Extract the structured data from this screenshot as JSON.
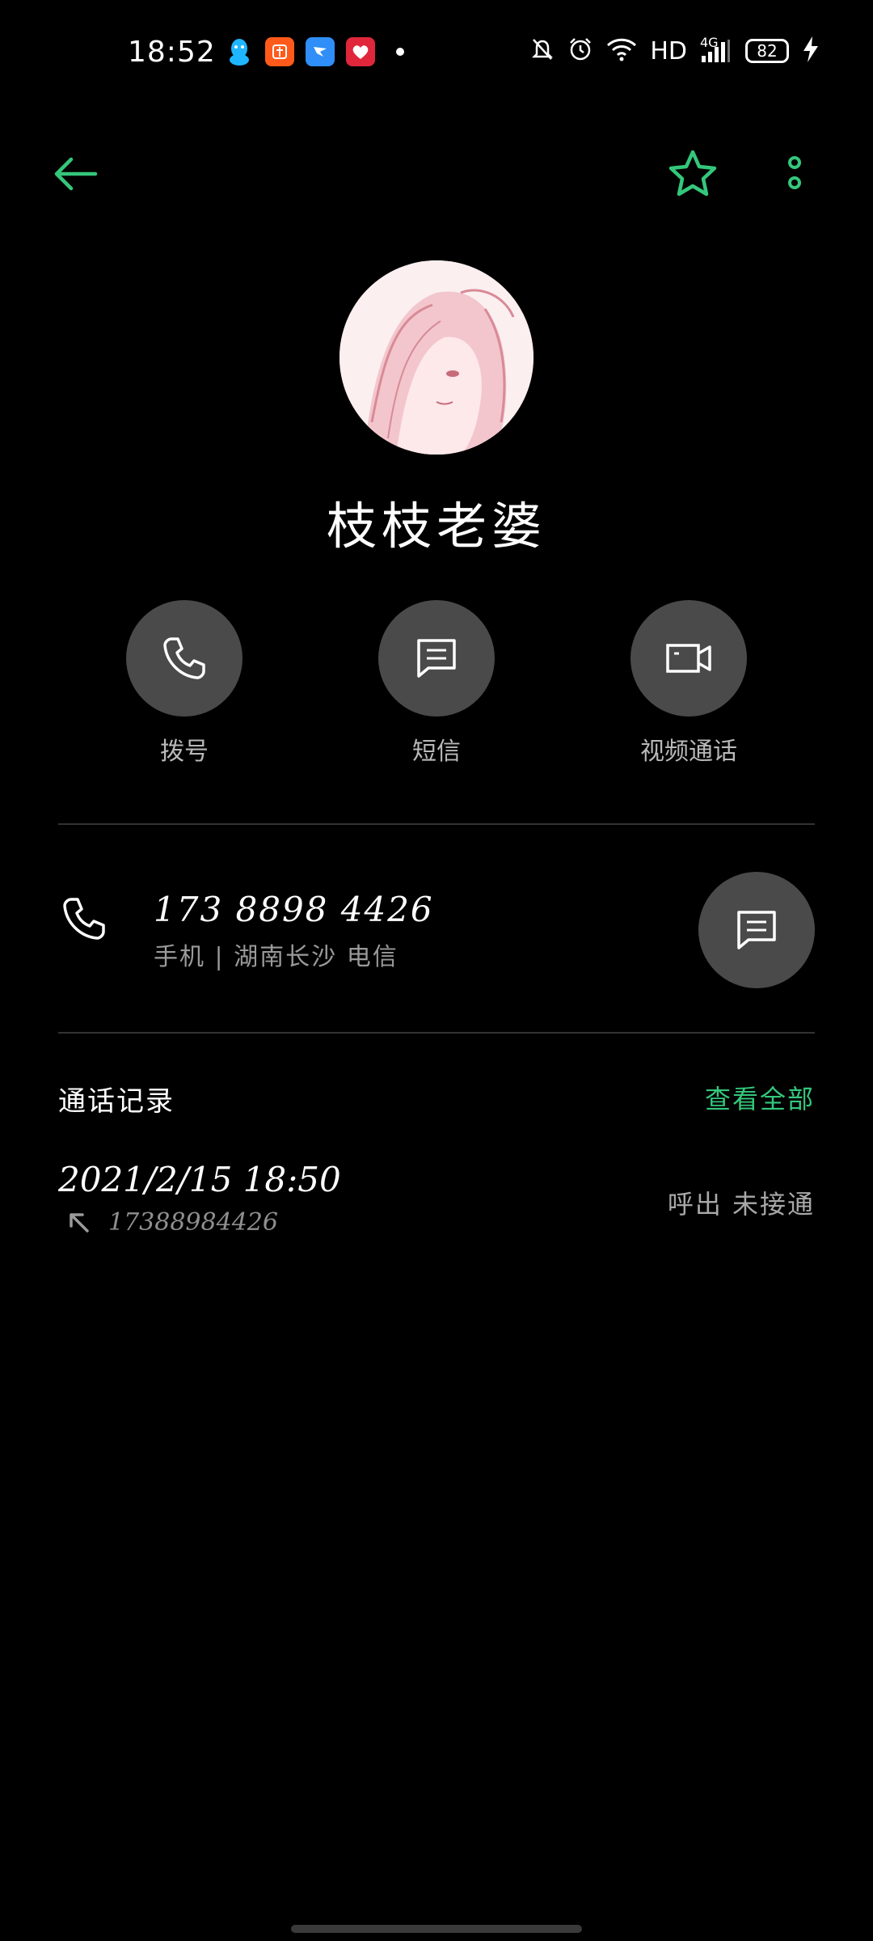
{
  "status_bar": {
    "time": "18:52",
    "hd_label": "HD",
    "network_label": "4G",
    "battery": "82",
    "icons": [
      "qq-icon",
      "taobao-icon",
      "dingtalk-icon",
      "heart-app-icon",
      "notification-dot",
      "mute-icon",
      "alarm-icon",
      "wifi-icon",
      "signal-icon",
      "charging-icon"
    ]
  },
  "top_bar": {
    "back_icon": "arrow-left-icon",
    "favorite_icon": "star-icon",
    "more_icon": "more-vertical-icon",
    "accent_color": "#34c77b"
  },
  "contact": {
    "name": "枝枝老婆",
    "avatar": "avatar"
  },
  "quick_actions": [
    {
      "label": "拨号",
      "icon": "phone-icon"
    },
    {
      "label": "短信",
      "icon": "message-icon"
    },
    {
      "label": "视频通话",
      "icon": "video-icon"
    }
  ],
  "phone_entry": {
    "number": "173 8898 4426",
    "subtitle": "手机 | 湖南长沙 电信",
    "message_icon": "message-icon"
  },
  "call_log": {
    "title": "通话记录",
    "view_all": "查看全部",
    "entries": [
      {
        "time": "2021/2/15 18:50",
        "number": "17388984426",
        "status": "呼出 未接通",
        "direction_icon": "outgoing-call-arrow-icon"
      }
    ]
  }
}
